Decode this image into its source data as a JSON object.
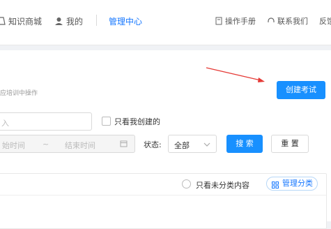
{
  "nav": {
    "items": [
      {
        "label": "知识商城",
        "icon": "shopping-icon"
      },
      {
        "label": "我的",
        "icon": "user-icon"
      },
      {
        "label": "管理中心",
        "icon": ""
      }
    ],
    "manual": "操作手册",
    "contact": "联系我们",
    "feedback": "反馈"
  },
  "page": {
    "tip": "应培训中操作",
    "create_label": "创建考试"
  },
  "filters": {
    "name_placeholder": "入",
    "only_mine_label": "只看我创建的",
    "start_placeholder": "始时间",
    "range_sep": "~",
    "end_placeholder": "结束时间",
    "status_label": "状态:",
    "status_value": "全部",
    "search_label": "搜 索",
    "reset_label": "重 置"
  },
  "list": {
    "uncategorized_label": "只看未分类内容",
    "manage_label": "管理分类"
  },
  "colors": {
    "accent": "#1890ff",
    "annotation": "#e53935"
  }
}
